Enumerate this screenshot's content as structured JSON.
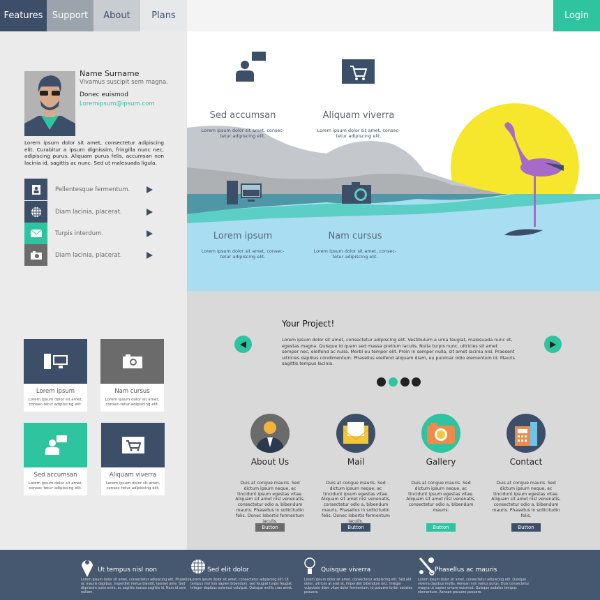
{
  "nav": {
    "tabs": [
      {
        "label": "Features"
      },
      {
        "label": "Support"
      },
      {
        "label": "About"
      },
      {
        "label": "Plans"
      }
    ],
    "login": "Login"
  },
  "colors": {
    "dark": "#3d4f68",
    "accent": "#2ec4a0",
    "gray": "#6b6b6b",
    "sun": "#f6e62c",
    "flamingo": "#a66bc9",
    "footer": "#46586f"
  },
  "profile": {
    "name": "Name Surname",
    "tagline": "Vivamus suscipit sem magna.",
    "subtitle": "Donec euismod",
    "email": "Loremipsum@ipsum.com",
    "bio": "Lorem ipsum dolor sit amet, consectetur adipiscing elit. Curabitur a ipsum dignissim, fringilla nunc nec, adipiscing purus. Aliquam purus felis, accumsan non lacinia id, sagittis ac nunc. Sed ut malesuada ligula."
  },
  "sidebar": {
    "items": [
      {
        "label": "Pellentesque fermentum.",
        "icon": "contact-icon"
      },
      {
        "label": "Diam lacinia, placerat.",
        "icon": "globe-icon"
      },
      {
        "label": "Turpis interdum.",
        "icon": "mail-icon"
      },
      {
        "label": "Diam lacinia, placerat.",
        "icon": "camera-icon"
      }
    ]
  },
  "cards": [
    {
      "title": "Lorem ipsum",
      "desc": "Lorem ipsum dolor sit amet, consec-tetur adipiscing elit.",
      "icon": "computer-icon"
    },
    {
      "title": "Nam cursus",
      "desc": "Lorem ipsum dolor sit amet, consec-tetur adipiscing elit.",
      "icon": "camera-icon"
    },
    {
      "title": "Sed accumsan",
      "desc": "Lorem ipsum dolor sit amet, consec-tetur adipiscing elit.",
      "icon": "user-chat-icon"
    },
    {
      "title": "Aliquam viverra",
      "desc": "Lorem ipsum dolor sit amet, consec-tetur adipiscing elit.",
      "icon": "cart-icon"
    }
  ],
  "hero": {
    "features": [
      {
        "title": "Sed accumsan",
        "desc": "Lorem ipsum dolor sit amet, consec-tetur adipiscing elit."
      },
      {
        "title": "Aliquam viverra",
        "desc": "Lorem ipsum dolor sit amet, consec-tetur adipiscing elit."
      },
      {
        "title": "Lorem ipsum",
        "desc": "Lorem ipsum dolor sit amet, consec-tetur adipiscing elit."
      },
      {
        "title": "Nam cursus",
        "desc": "Lorem ipsum dolor sit amet, consec-tetur adipiscing elit."
      }
    ]
  },
  "project": {
    "title": "Your Project!",
    "body": "Lorem ipsum dolor sit amet, consectetur adipiscing elit. Vestibulum a urna feugiat, malesuada nunc et, egestas magna. Quisque id quam sed massa pretium iaculis. Nulla turpis nunc, ultricies sit amet semper nec, eleifend ac nulla. Morbi eu tempor elit. Proin in semper nulla, sit amet lacinia nisi. Praesent ultricies dapibus condimentum. Phasellus eleifend aliquam diam, eu pulvinar odio elementum id. Mauris sagittis tempus lacinia.",
    "slides": 4,
    "active_slide": 2
  },
  "services": [
    {
      "title": "About Us",
      "desc": "Duis at congue mauris. Sed dictum ipsum neque, ac tincidunt ipsum egestas vitae. Aliquam sit amet nisl venenatis, consectetur odio a, bibendum mauris. Phasellus in sollicitudin felis. Donec lobortis fermentum iaculis.",
      "button": "Button",
      "color": "#6b6b6b"
    },
    {
      "title": "Mail",
      "desc": "Duis at congue mauris. Sed dictum ipsum neque, ac tincidunt ipsum egestas vitae. Aliquam sit amet nisl venenatis, consectetur odio a, bibendum mauris. Phasellus in sollicitudin felis. Donec lobortis fermentum iaculis.",
      "button": "Button",
      "color": "#3d4f68"
    },
    {
      "title": "Gallery",
      "desc": "Duis at congue mauris. Sed dictum ipsum neque, ac tincidunt ipsum egestas vitae. Aliquam sit amet nisl venenatis, consectetur odio a, bibendum mauris.",
      "button": "Button",
      "color": "#2ec4a0"
    },
    {
      "title": "Contact",
      "desc": "Duis at congue mauris. Sed dictum ipsum neque, ac tincidunt ipsum egestas vitae. Aliquam sit amet nisl venenatis, consectetur odio a, bibendum mauris. Phasellus in sollicitudin felis.",
      "button": "Button",
      "color": "#3d4f68"
    }
  ],
  "footer": [
    {
      "title": "Ut tempus nisl non",
      "icon": "location-pin-icon",
      "desc": "Lorem ipsum dolor sit amet, consectetur adipiscing elit. Phasellus ac mauris dapibus, imperdiet metus blandit, laoreet ante. Sed dignissim justo enim, ac sagittis massa sagittis id. Nam id sem nullam."
    },
    {
      "title": "Sed elit dolor",
      "icon": "globe-icon",
      "desc": "Lorem ipsum dolor sit amet, consectetur adipiscing elit. Ut tempus nisl non sapien bibendum, sed feugiat turpis feugiat. Integer dapibus euismod volutpat. Quisque mollis cras amet."
    },
    {
      "title": "Quisque viverra",
      "icon": "lightbulb-icon",
      "desc": "Lorem ipsum dolor sit amet, consectetur adipiscing elit. Sed elit dolor, ultrices at erat at, imperdiet bibendum orci. Integer vulputate diam vitae dolor fermentum, id posuere tortor sodales posuere."
    },
    {
      "title": "Phasellus ac mauris",
      "icon": "tools-icon",
      "desc": "Lorem ipsum dolor sit amet, consectetur adipiscing elit. Quisque viverra dapibus mollis. Aenean non varius purus. Duis consectetur magna ut sapien ornare euismod. Quisque sodales tempus elementum. Aenean posuere posuere."
    }
  ]
}
